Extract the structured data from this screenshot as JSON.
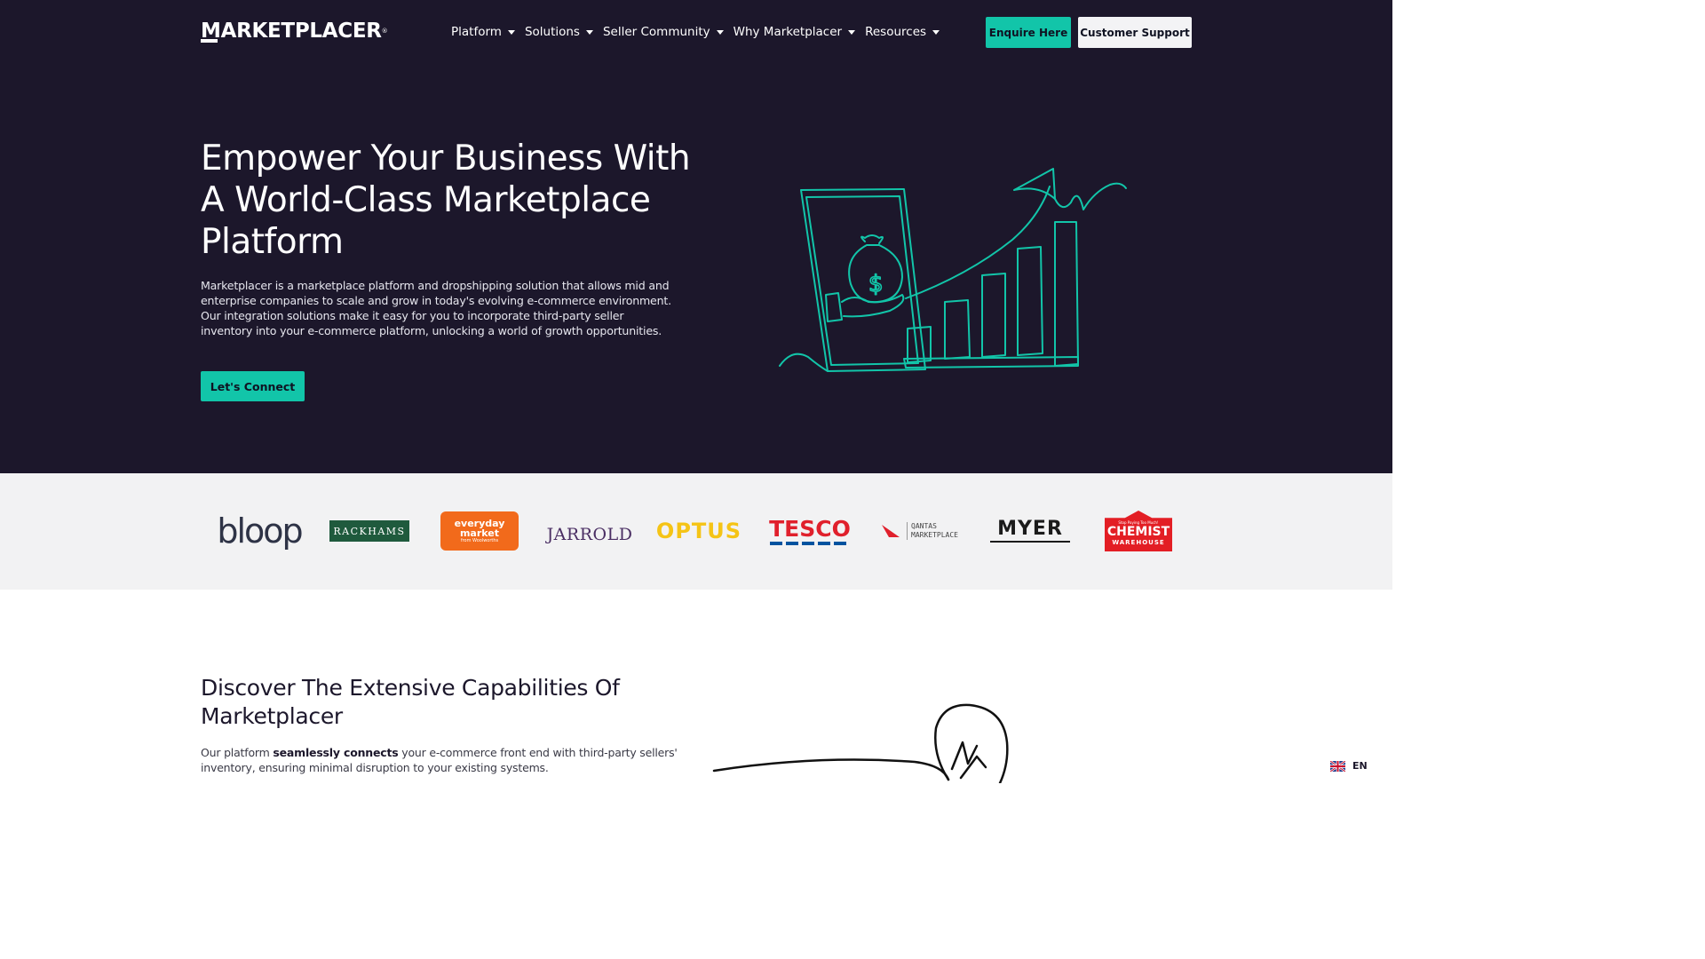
{
  "header": {
    "logo_text": "MARKETPLACER",
    "logo_tm": "®",
    "nav": [
      {
        "label": "Platform"
      },
      {
        "label": "Solutions"
      },
      {
        "label": "Seller Community"
      },
      {
        "label": "Why Marketplacer"
      },
      {
        "label": "Resources"
      }
    ],
    "enquire_label": "Enquire Here",
    "support_label": "Customer Support"
  },
  "hero": {
    "title": "Empower Your Business With A World-Class Marketplace Platform",
    "description": "Marketplacer is a marketplace platform and dropshipping solution that allows mid and enterprise companies to scale and grow in today's evolving e-commerce environment. Our integration solutions make it easy for you to incorporate third-party seller inventory into your e-commerce platform, unlocking a world of growth opportunities.",
    "cta_label": "Let's Connect",
    "illustration": "hand-drawn-growth-chart-icon"
  },
  "partners": {
    "bloop": "bloop",
    "rackhams": "RACKHAMS",
    "everyday_1": "everyday",
    "everyday_2": "market",
    "everyday_3": "from Woolworths",
    "jarrold": "JARROLD",
    "optus": "OPTUS",
    "tesco": "TESCO",
    "qantas_1": "QANTAS",
    "qantas_2": "MARKETPLACE",
    "myer": "MYER",
    "chemist_1": "Stop Paying Too Much!",
    "chemist_2": "CHEMIST",
    "chemist_3": "WAREHOUSE"
  },
  "capabilities": {
    "title": "Discover The Extensive Capabilities Of Marketplacer",
    "desc_pre": "Our platform ",
    "desc_bold": "seamlessly connects",
    "desc_post": " your e-commerce front end with third-party sellers' inventory, ensuring minimal disruption to your existing systems."
  },
  "language": {
    "code": "EN",
    "flag": "uk-flag-icon"
  },
  "colors": {
    "hero_bg": "#1c172b",
    "accent": "#12c5a9",
    "logo_strip_bg": "#f2f2f3"
  }
}
